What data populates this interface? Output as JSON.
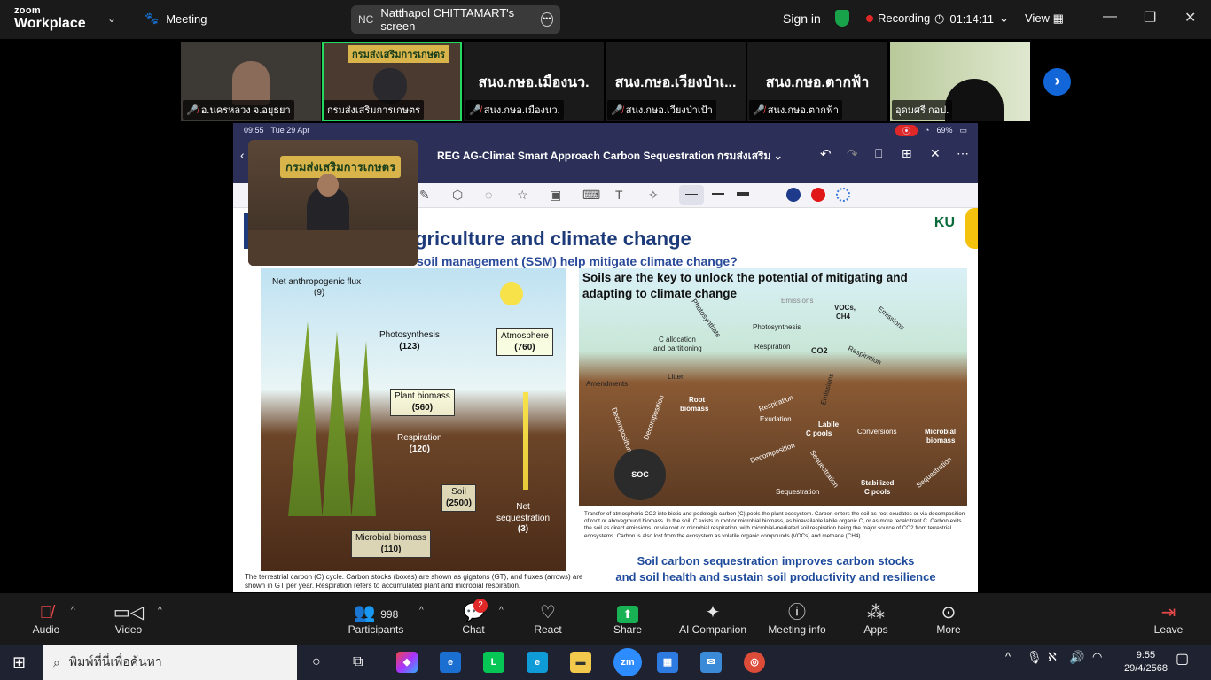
{
  "titlebar": {
    "brand_top": "zoom",
    "brand_bottom": "Workplace",
    "meeting_label": "Meeting",
    "screen_initials": "NC",
    "screen_label": "Natthapol CHITTAMART's screen",
    "sign_in": "Sign in",
    "recording": "Recording",
    "timer": "01:14:11",
    "view": "View"
  },
  "gallery": {
    "tiles": [
      {
        "label": "อ.นครหลวง จ.อยุธยา",
        "big": "",
        "mic_off": true
      },
      {
        "label": "กรมส่งเสริมการเกษตร",
        "big": "กรมส่งเสริมการเกษตร",
        "mic_off": false
      },
      {
        "label": "สนง.กษอ.เมืองนว.",
        "big": "สนง.กษอ.เมืองนว.",
        "mic_off": true
      },
      {
        "label": "สนง.กษอ.เวียงป่าเป้า",
        "big": "สนง.กษอ.เวียงป่าเ...",
        "mic_off": true
      },
      {
        "label": "สนง.กษอ.ตากฟ้า",
        "big": "สนง.กษอ.ตากฟ้า",
        "mic_off": true
      },
      {
        "label": "อุดมศรี กอป.",
        "big": "",
        "mic_off": false
      }
    ]
  },
  "share": {
    "status_time": "09:55",
    "status_date": "Tue 29 Apr",
    "battery": "69%",
    "doc_title": "REG AG-Climat Smart Approach Carbon Sequestration กรมส่งเสริม",
    "pip_banner": "กรมส่งเสริมการเกษตร",
    "slide": {
      "h1": "griculture and climate change",
      "h2": "soil management (SSM) help mitigate climate change?",
      "logo": "KU",
      "left": {
        "flux": "Net anthropogenic flux",
        "flux_val": "(9)",
        "photo": "Photosynthesis",
        "photo_val": "(123)",
        "atmo": "Atmosphere",
        "atmo_val": "(760)",
        "plant": "Plant biomass",
        "plant_val": "(560)",
        "resp": "Respiration",
        "resp_val": "(120)",
        "soil": "Soil",
        "soil_val": "(2500)",
        "net": "Net",
        "net2": "sequestration",
        "net_val": "(3)",
        "micro": "Microbial biomass",
        "micro_val": "(110)"
      },
      "right_title": "Soils are the key to unlock the potential of mitigating and adapting to climate change",
      "right": {
        "emissions": "Emissions",
        "vocs": "VOCs,",
        "ch4": "CH4",
        "photosynthate": "Photosynthate",
        "photosynthesis": "Photosynthesis",
        "c_alloc": "C allocation",
        "c_alloc2": "and partitioning",
        "respiration": "Respiration",
        "co2": "CO2",
        "respiration2": "Respiration",
        "emissions2": "Emissions",
        "amendments": "Amendments",
        "litter": "Litter",
        "root": "Root",
        "root2": "biomass",
        "exudation": "Exudation",
        "labile": "Labile",
        "labile2": "C pools",
        "conversions": "Conversions",
        "microbial": "Microbial",
        "microbial2": "biomass",
        "decomposition": "Decomposition",
        "soc": "SOC",
        "sequestration": "Sequestration",
        "stabilized": "Stabilized",
        "stabilized2": "C pools"
      },
      "caption_right": "Transfer of atmospheric CO2 into biotic and pedologic carbon (C) pools the plant ecosystem. Carbon enters the soil as root exudates or via decomposition of root or aboveground biomass. In the soil, C exists in root or microbial biomass, as bioavailable labile organic C, or as more recalcitrant C. Carbon exits the soil as direct emissions, or via root or microbial respiration, with microbial-mediated soil respiration being the major source of CO2 from terrestrial ecosystems. Carbon is also lost from the ecosystem as volatile organic compounds (VOCs) and methane (CH4).",
      "summary1": "Soil carbon sequestration improves carbon stocks",
      "summary2": "and soil health and sustain soil productivity and resilience",
      "caption_left": "The terrestrial carbon (C) cycle. Carbon stocks (boxes) are shown as gigatons (GT), and fluxes (arrows) are shown in GT per year. Respiration refers to accumulated plant and microbial respiration."
    }
  },
  "controls": {
    "audio": "Audio",
    "video": "Video",
    "participants": "Participants",
    "participants_count": "998",
    "chat": "Chat",
    "chat_badge": "2",
    "react": "React",
    "share": "Share",
    "ai": "AI Companion",
    "info": "Meeting info",
    "apps": "Apps",
    "more": "More",
    "leave": "Leave"
  },
  "taskbar": {
    "search": "พิมพ์ที่นี่เพื่อค้นหา",
    "time": "9:55",
    "date": "29/4/2568",
    "zoom_app": "zm"
  }
}
